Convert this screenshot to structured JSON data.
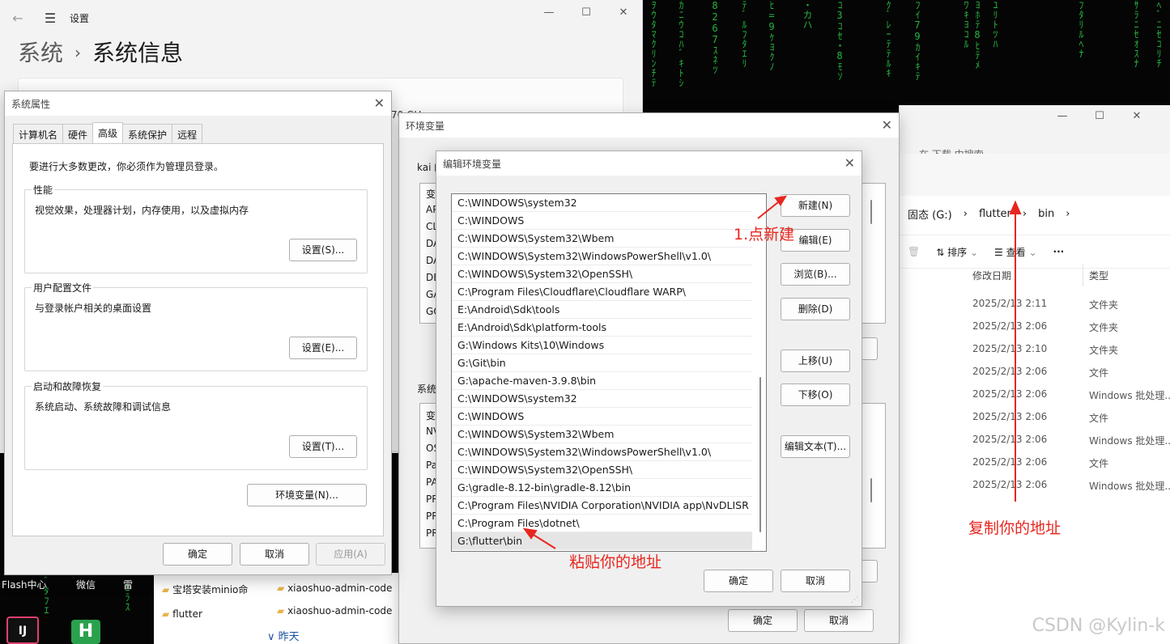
{
  "settings": {
    "title": "设置",
    "breadcrumb_root": "系统",
    "breadcrumb_page": "系统信息",
    "partial_text": "70 GH"
  },
  "sysprops": {
    "title": "系统属性",
    "tabs": [
      "计算机名",
      "硬件",
      "高级",
      "系统保护",
      "远程"
    ],
    "admin_note": "要进行大多数更改，你必须作为管理员登录。",
    "perf_title": "性能",
    "perf_desc": "视觉效果，处理器计划，内存使用，以及虚拟内存",
    "perf_btn": "设置(S)...",
    "profile_title": "用户配置文件",
    "profile_desc": "与登录帐户相关的桌面设置",
    "profile_btn": "设置(E)...",
    "startup_title": "启动和故障恢复",
    "startup_desc": "系统启动、系统故障和调试信息",
    "startup_btn": "设置(T)...",
    "env_btn": "环境变量(N)...",
    "ok": "确定",
    "cancel": "取消",
    "apply": "应用(A)"
  },
  "envvars": {
    "title": "环境变量",
    "user_section": "kai 的",
    "sys_section": "系统",
    "user_frags": [
      "变",
      "AP",
      "CL",
      "DA",
      "DA",
      "DE",
      "GA",
      "GO"
    ],
    "sys_frags": [
      "变",
      "NV",
      "OS",
      "Pa",
      "PA",
      "PR",
      "PR",
      "PR"
    ],
    "ok": "确定",
    "cancel": "取消"
  },
  "editenv": {
    "title": "编辑环境变量",
    "items": [
      "C:\\WINDOWS\\system32",
      "C:\\WINDOWS",
      "C:\\WINDOWS\\System32\\Wbem",
      "C:\\WINDOWS\\System32\\WindowsPowerShell\\v1.0\\",
      "C:\\WINDOWS\\System32\\OpenSSH\\",
      "C:\\Program Files\\Cloudflare\\Cloudflare WARP\\",
      "E:\\Android\\Sdk\\tools",
      "E:\\Android\\Sdk\\platform-tools",
      "G:\\Windows Kits\\10\\Windows",
      "G:\\Git\\bin",
      "G:\\apache-maven-3.9.8\\bin",
      "C:\\WINDOWS\\system32",
      "C:\\WINDOWS",
      "C:\\WINDOWS\\System32\\Wbem",
      "C:\\WINDOWS\\System32\\WindowsPowerShell\\v1.0\\",
      "C:\\WINDOWS\\System32\\OpenSSH\\",
      "G:\\gradle-8.12-bin\\gradle-8.12\\bin",
      "C:\\Program Files\\NVIDIA Corporation\\NVIDIA app\\NvDLISR",
      "C:\\Program Files\\dotnet\\",
      "G:\\flutter\\bin"
    ],
    "btn_new": "新建(N)",
    "btn_edit": "编辑(E)",
    "btn_browse": "浏览(B)...",
    "btn_delete": "删除(D)",
    "btn_up": "上移(U)",
    "btn_down": "下移(O)",
    "btn_edit_text": "编辑文本(T)...",
    "ok": "确定",
    "cancel": "取消"
  },
  "explorer": {
    "tab_partial": "在 下载 中搜索",
    "path": [
      "固态 (G:)",
      "flutter",
      "bin"
    ],
    "sort_label": "排序",
    "view_label": "查看",
    "more": "···",
    "col_date": "修改日期",
    "col_type": "类型",
    "rows": [
      {
        "date": "2025/2/13 2:11",
        "type": "文件夹"
      },
      {
        "date": "2025/2/13 2:06",
        "type": "文件夹"
      },
      {
        "date": "2025/2/13 2:10",
        "type": "文件夹"
      },
      {
        "date": "2025/2/13 2:06",
        "type": "文件"
      },
      {
        "date": "2025/2/13 2:06",
        "type": "Windows 批处理..."
      },
      {
        "date": "2025/2/13 2:06",
        "type": "文件"
      },
      {
        "date": "2025/2/13 2:06",
        "type": "Windows 批处理..."
      },
      {
        "date": "2025/2/13 2:06",
        "type": "文件"
      },
      {
        "date": "2025/2/13 2:06",
        "type": "Windows 批处理..."
      }
    ]
  },
  "background": {
    "folders": [
      "宝塔安装minio命",
      "flutter",
      "xiaoshuo-admin-code",
      "xiaoshuo-admin-code"
    ],
    "yesterday": "昨天",
    "taskbar_labels": [
      "Flash中心",
      "微信",
      "雷"
    ],
    "app_ij": "IJ",
    "app_h": "H"
  },
  "annotations": {
    "click_new": "1.点新建",
    "copy_addr": "复制你的地址",
    "paste_addr": "粘贴你的地址"
  },
  "watermark": "CSDN @Kylin-k",
  "colors": {
    "annotation": "#e8261f",
    "matrix": "#2bd24b"
  }
}
